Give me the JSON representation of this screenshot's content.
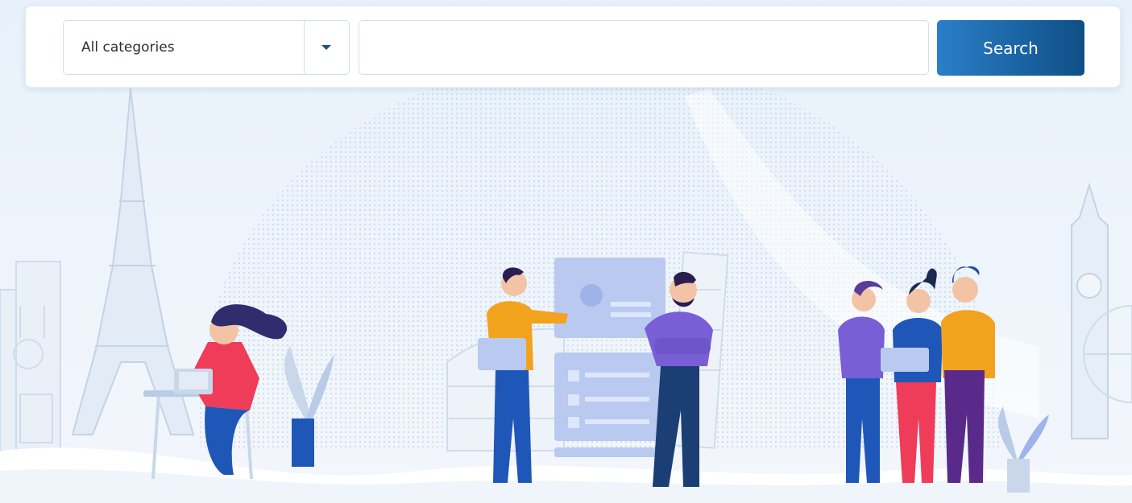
{
  "search_bar": {
    "category_select": {
      "selected": "All categories"
    },
    "input": {
      "value": "",
      "placeholder": ""
    },
    "button_label": "Search"
  },
  "hero": {
    "illustration": "professionals-in-world-cities",
    "colors": {
      "background": "#eef4fb",
      "accent_blue": "#1f57b8",
      "accent_orange": "#f3a21e",
      "accent_red": "#ee3c59",
      "accent_purple": "#7a5ed6",
      "landmark_tint": "#cfdcec"
    },
    "icons": [
      "chevron-down-icon",
      "eiffel-tower-icon",
      "notre-dame-icon",
      "colosseum-icon",
      "leaning-tower-icon",
      "big-ben-icon",
      "ferris-wheel-icon"
    ]
  }
}
